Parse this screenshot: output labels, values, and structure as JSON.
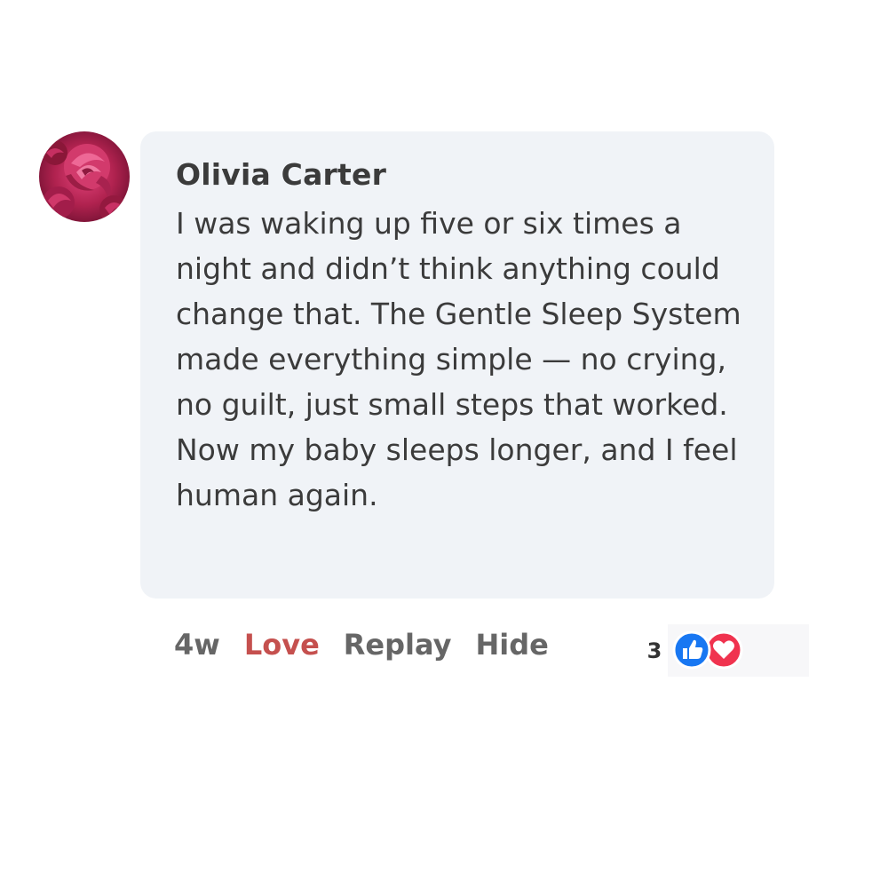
{
  "comment": {
    "author": "Olivia Carter",
    "text": "I was waking up five or six times a night and didn’t think anything could change that. The Gentle Sleep System made everything simple — no crying, no guilt, just small steps that worked. Now my baby sleeps longer, and I feel human again.",
    "avatar_icon": "rose-avatar"
  },
  "actions": {
    "time": "4w",
    "love_label": "Love",
    "replay_label": "Replay",
    "hide_label": "Hide"
  },
  "reactions": {
    "count": "3",
    "icons": [
      "like-icon",
      "heart-icon"
    ]
  },
  "colors": {
    "bubble_bg": "#f0f3f7",
    "text": "#3b3b3b",
    "action_gray": "#666666",
    "love_red": "#c5504e",
    "like_blue": "#1877f2",
    "heart_red": "#f0334f"
  }
}
